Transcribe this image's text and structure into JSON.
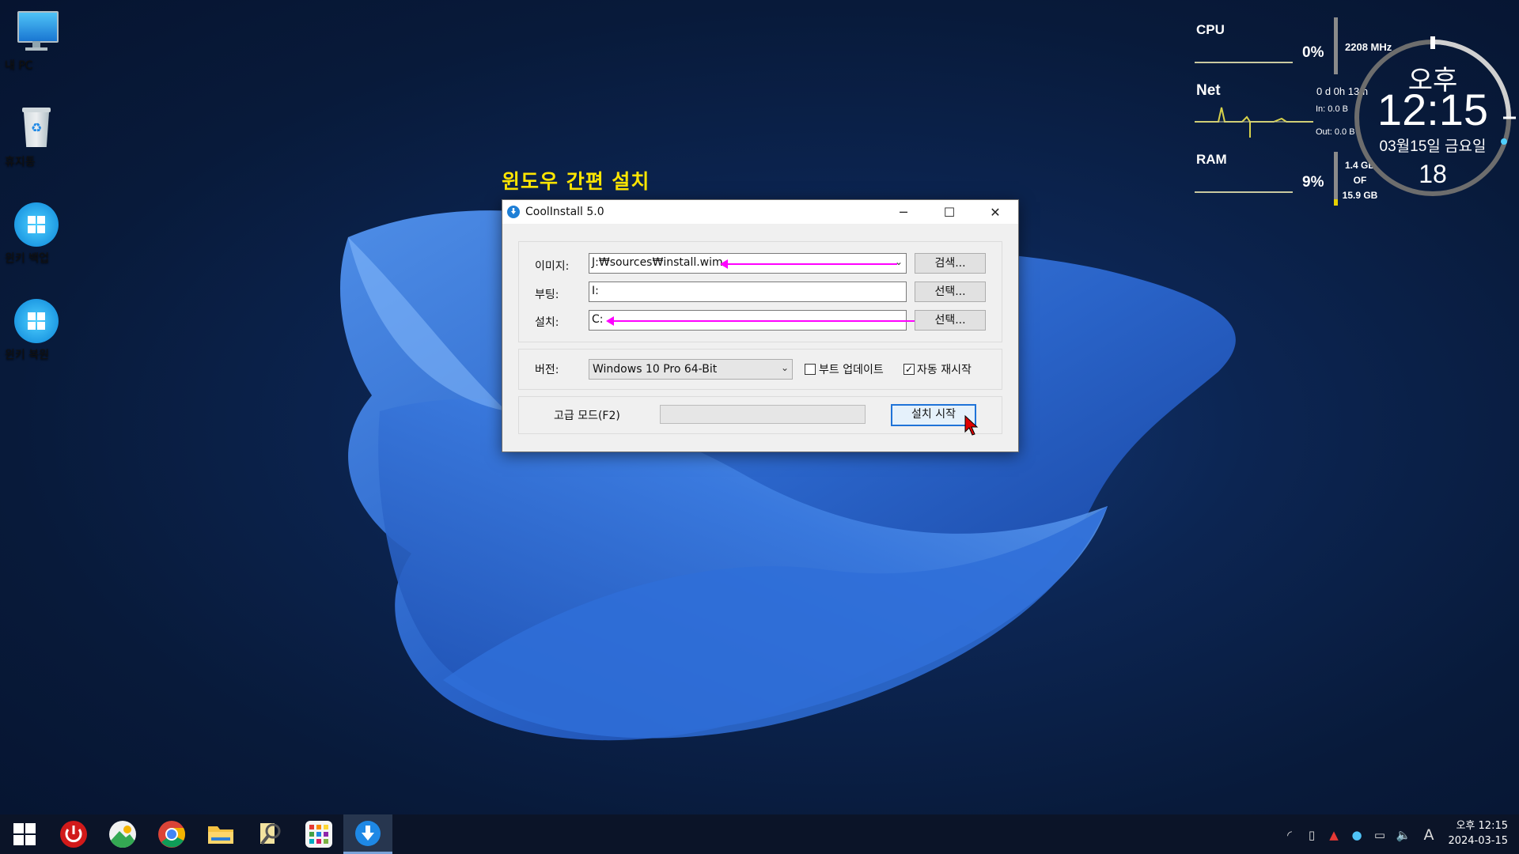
{
  "desktop": {
    "icons": [
      {
        "label": "내 PC",
        "icon": "monitor-icon"
      },
      {
        "label": "휴지통",
        "icon": "recycle-bin-icon"
      },
      {
        "label": "윈키 백업",
        "icon": "windows-logo-icon"
      },
      {
        "label": "윈키 복원",
        "icon": "windows-logo-icon"
      }
    ],
    "heading": "윈도우 간편 설치"
  },
  "gadget": {
    "cpu_label": "CPU",
    "cpu_percent": "0%",
    "cpu_freq": "2208 MHz",
    "net_label": "Net",
    "uptime": "0 d 0h 13m",
    "net_in": "In: 0.0 B",
    "net_out": "Out: 0.0 B",
    "ram_label": "RAM",
    "ram_percent": "9%",
    "ram_used": "1.4 GB",
    "ram_of": "OF",
    "ram_total": "15.9 GB",
    "clock_ampm": "오후",
    "clock_time": "12:15",
    "clock_date": "03월15일 금요일",
    "clock_seconds": "18"
  },
  "window": {
    "title": "CoolInstall 5.0",
    "image_label": "이미지:",
    "image_value": "J:₩sources₩install.wim",
    "search_button": "검색...",
    "boot_label": "부팅:",
    "boot_value": "I:",
    "boot_select_button": "선택...",
    "install_label": "설치:",
    "install_value": "C:",
    "install_select_button": "선택...",
    "version_label": "버전:",
    "version_value": "Windows 10 Pro  64-Bit",
    "boot_update_label": "부트 업데이트",
    "boot_update_checked": false,
    "auto_restart_label": "자동 재시작",
    "auto_restart_checked": true,
    "advanced_mode_label": "고급 모드(F2)",
    "start_button": "설치 시작"
  },
  "taskbar": {
    "tray_time": "오후 12:15",
    "tray_date": "2024-03-15",
    "ime": "A"
  },
  "colors": {
    "heading": "#ffe600",
    "annotation_arrow": "#ff00ff",
    "accent": "#1f73d8"
  }
}
